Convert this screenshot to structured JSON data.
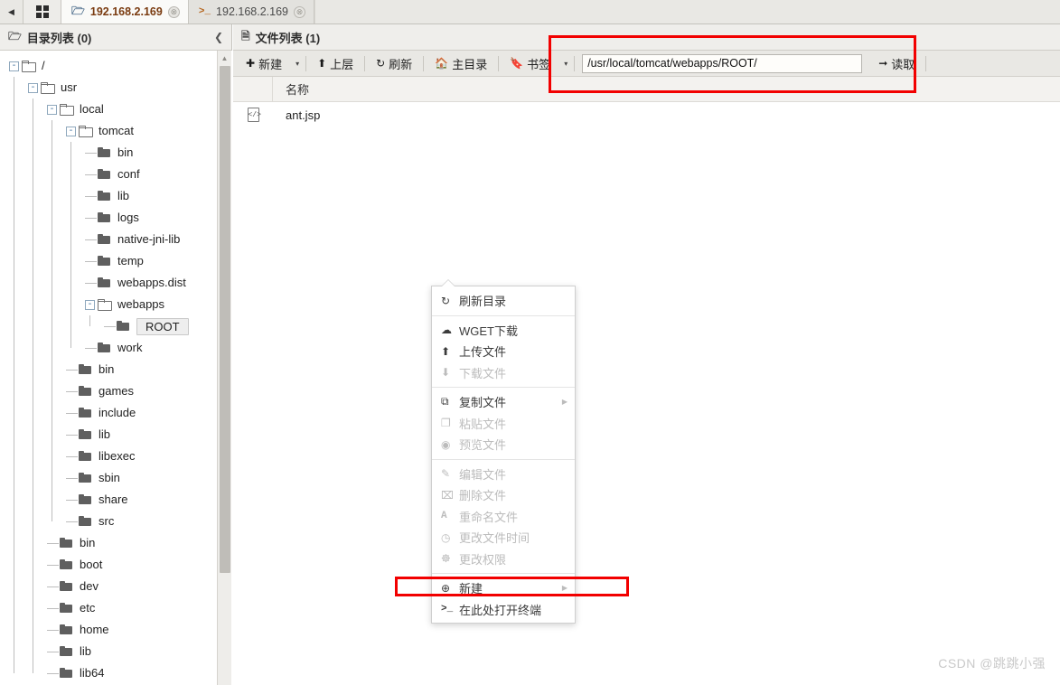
{
  "tabbar": {
    "nav_left_icon": "chevron-left-icon",
    "grid_icon": "grid-icon",
    "tabs": [
      {
        "label": "192.168.2.169",
        "icon": "folder-icon",
        "close": "⊗",
        "active": true
      },
      {
        "label": "192.168.2.169",
        "icon": "terminal-icon",
        "close": "⊗",
        "active": false
      }
    ],
    "terminal_prefix": ">_"
  },
  "sidebar": {
    "title": "目录列表 (0)",
    "title_icon": "folder-icon",
    "collapse_icon": "chevron-left-icon",
    "tree": [
      {
        "label": "/",
        "depth": 0,
        "expander": "-",
        "folder": "open",
        "selected": false
      },
      {
        "label": "usr",
        "depth": 1,
        "expander": "-",
        "folder": "open",
        "selected": false
      },
      {
        "label": "local",
        "depth": 2,
        "expander": "-",
        "folder": "open",
        "selected": false
      },
      {
        "label": "tomcat",
        "depth": 3,
        "expander": "-",
        "folder": "open",
        "selected": false
      },
      {
        "label": "bin",
        "depth": 4,
        "expander": "",
        "folder": "solid",
        "selected": false
      },
      {
        "label": "conf",
        "depth": 4,
        "expander": "",
        "folder": "solid",
        "selected": false
      },
      {
        "label": "lib",
        "depth": 4,
        "expander": "",
        "folder": "solid",
        "selected": false
      },
      {
        "label": "logs",
        "depth": 4,
        "expander": "",
        "folder": "solid",
        "selected": false
      },
      {
        "label": "native-jni-lib",
        "depth": 4,
        "expander": "",
        "folder": "solid",
        "selected": false
      },
      {
        "label": "temp",
        "depth": 4,
        "expander": "",
        "folder": "solid",
        "selected": false
      },
      {
        "label": "webapps.dist",
        "depth": 4,
        "expander": "",
        "folder": "solid",
        "selected": false
      },
      {
        "label": "webapps",
        "depth": 4,
        "expander": "-",
        "folder": "open",
        "selected": false
      },
      {
        "label": "ROOT",
        "depth": 5,
        "expander": "",
        "folder": "solid",
        "selected": true
      },
      {
        "label": "work",
        "depth": 4,
        "expander": "",
        "folder": "solid",
        "selected": false
      },
      {
        "label": "bin",
        "depth": 3,
        "expander": "",
        "folder": "solid",
        "selected": false
      },
      {
        "label": "games",
        "depth": 3,
        "expander": "",
        "folder": "solid",
        "selected": false
      },
      {
        "label": "include",
        "depth": 3,
        "expander": "",
        "folder": "solid",
        "selected": false
      },
      {
        "label": "lib",
        "depth": 3,
        "expander": "",
        "folder": "solid",
        "selected": false
      },
      {
        "label": "libexec",
        "depth": 3,
        "expander": "",
        "folder": "solid",
        "selected": false
      },
      {
        "label": "sbin",
        "depth": 3,
        "expander": "",
        "folder": "solid",
        "selected": false
      },
      {
        "label": "share",
        "depth": 3,
        "expander": "",
        "folder": "solid",
        "selected": false
      },
      {
        "label": "src",
        "depth": 3,
        "expander": "",
        "folder": "solid",
        "selected": false
      },
      {
        "label": "bin",
        "depth": 2,
        "expander": "",
        "folder": "solid",
        "selected": false
      },
      {
        "label": "boot",
        "depth": 2,
        "expander": "",
        "folder": "solid",
        "selected": false
      },
      {
        "label": "dev",
        "depth": 2,
        "expander": "",
        "folder": "solid",
        "selected": false
      },
      {
        "label": "etc",
        "depth": 2,
        "expander": "",
        "folder": "solid",
        "selected": false
      },
      {
        "label": "home",
        "depth": 2,
        "expander": "",
        "folder": "solid",
        "selected": false
      },
      {
        "label": "lib",
        "depth": 2,
        "expander": "",
        "folder": "solid",
        "selected": false
      },
      {
        "label": "lib64",
        "depth": 2,
        "expander": "",
        "folder": "solid",
        "selected": false
      }
    ]
  },
  "filepanel": {
    "title": "文件列表 (1)",
    "title_icon": "file-icon",
    "toolbar": {
      "new_label": "新建",
      "new_icon": "plus-circle-icon",
      "new_caret": "▾",
      "up_label": "上层",
      "up_icon": "arrow-up-icon",
      "refresh_label": "刷新",
      "refresh_icon": "refresh-icon",
      "home_label": "主目录",
      "home_icon": "home-icon",
      "bookmark_label": "书签",
      "bookmark_icon": "bookmark-icon",
      "bookmark_caret": "▾",
      "address_value": "/usr/local/tomcat/webapps/ROOT/",
      "address_placeholder": "/",
      "read_label": "读取",
      "read_icon": "arrow-right-icon"
    },
    "columns": [
      "名称"
    ],
    "rows": [
      {
        "name": "ant.jsp",
        "icon": "code-file-icon"
      }
    ]
  },
  "contextmenu": {
    "groups": [
      [
        {
          "label": "刷新目录",
          "icon": "refresh-icon",
          "disabled": false,
          "submenu": false
        }
      ],
      [
        {
          "label": "WGET下载",
          "icon": "cloud-icon",
          "disabled": false,
          "submenu": false
        },
        {
          "label": "上传文件",
          "icon": "upload-icon",
          "disabled": false,
          "submenu": false
        },
        {
          "label": "下载文件",
          "icon": "download-icon",
          "disabled": true,
          "submenu": false
        }
      ],
      [
        {
          "label": "复制文件",
          "icon": "copy-icon",
          "disabled": false,
          "submenu": true
        },
        {
          "label": "粘贴文件",
          "icon": "paste-icon",
          "disabled": true,
          "submenu": false
        },
        {
          "label": "预览文件",
          "icon": "eye-icon",
          "disabled": true,
          "submenu": false
        }
      ],
      [
        {
          "label": "编辑文件",
          "icon": "edit-icon",
          "disabled": true,
          "submenu": false
        },
        {
          "label": "删除文件",
          "icon": "trash-icon",
          "disabled": true,
          "submenu": false
        },
        {
          "label": "重命名文件",
          "icon": "font-a-icon",
          "disabled": true,
          "submenu": false
        },
        {
          "label": "更改文件时间",
          "icon": "clock-icon",
          "disabled": true,
          "submenu": false
        },
        {
          "label": "更改权限",
          "icon": "users-icon",
          "disabled": true,
          "submenu": false
        }
      ],
      [
        {
          "label": "新建",
          "icon": "plus-circle-icon",
          "disabled": false,
          "submenu": true
        },
        {
          "label": "在此处打开终端",
          "icon": "terminal-icon",
          "disabled": false,
          "submenu": false
        }
      ]
    ],
    "submenu_arrow": "▶"
  },
  "annotations": {
    "color": "#f20000",
    "boxes": [
      "address-bar-highlight",
      "new-menu-item-highlight"
    ]
  },
  "watermark": "CSDN @跳跳小强"
}
